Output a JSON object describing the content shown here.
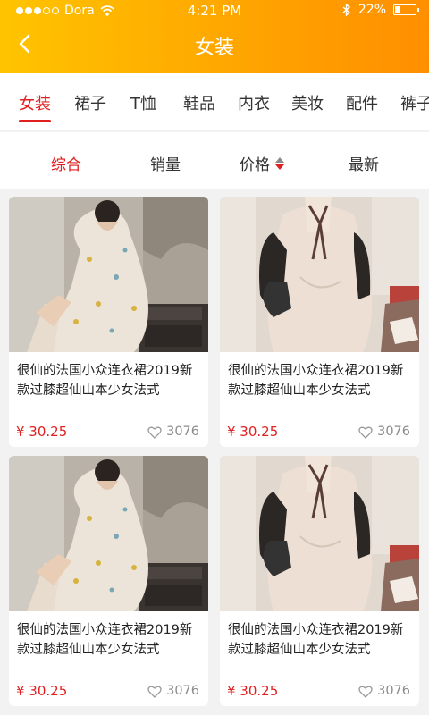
{
  "status": {
    "carrier": "Dora",
    "time": "4:21 PM",
    "battery": "22%",
    "battery_level": 0.22
  },
  "nav": {
    "title": "女装"
  },
  "tabs": [
    "女装",
    "裙子",
    "T恤",
    "鞋品",
    "内衣",
    "美妆",
    "配件",
    "裤子"
  ],
  "sort": {
    "comprehensive": "综合",
    "sales": "销量",
    "price": "价格",
    "newest": "最新"
  },
  "products": [
    {
      "name": "很仙的法国小众连衣裙2019新款过膝超仙山本少女法式",
      "price": "¥ 30.25",
      "likes": "3076",
      "image": "floral-dress-photo"
    },
    {
      "name": "很仙的法国小众连衣裙2019新款过膝超仙山本少女法式",
      "price": "¥ 30.25",
      "likes": "3076",
      "image": "beige-shirt-dress-photo"
    },
    {
      "name": "很仙的法国小众连衣裙2019新款过膝超仙山本少女法式",
      "price": "¥ 30.25",
      "likes": "3076",
      "image": "floral-dress-photo"
    },
    {
      "name": "很仙的法国小众连衣裙2019新款过膝超仙山本少女法式",
      "price": "¥ 30.25",
      "likes": "3076",
      "image": "beige-shirt-dress-photo"
    }
  ],
  "colors": {
    "accent": "#e02020",
    "header_start": "#ffc400",
    "header_end": "#ff8f00"
  }
}
